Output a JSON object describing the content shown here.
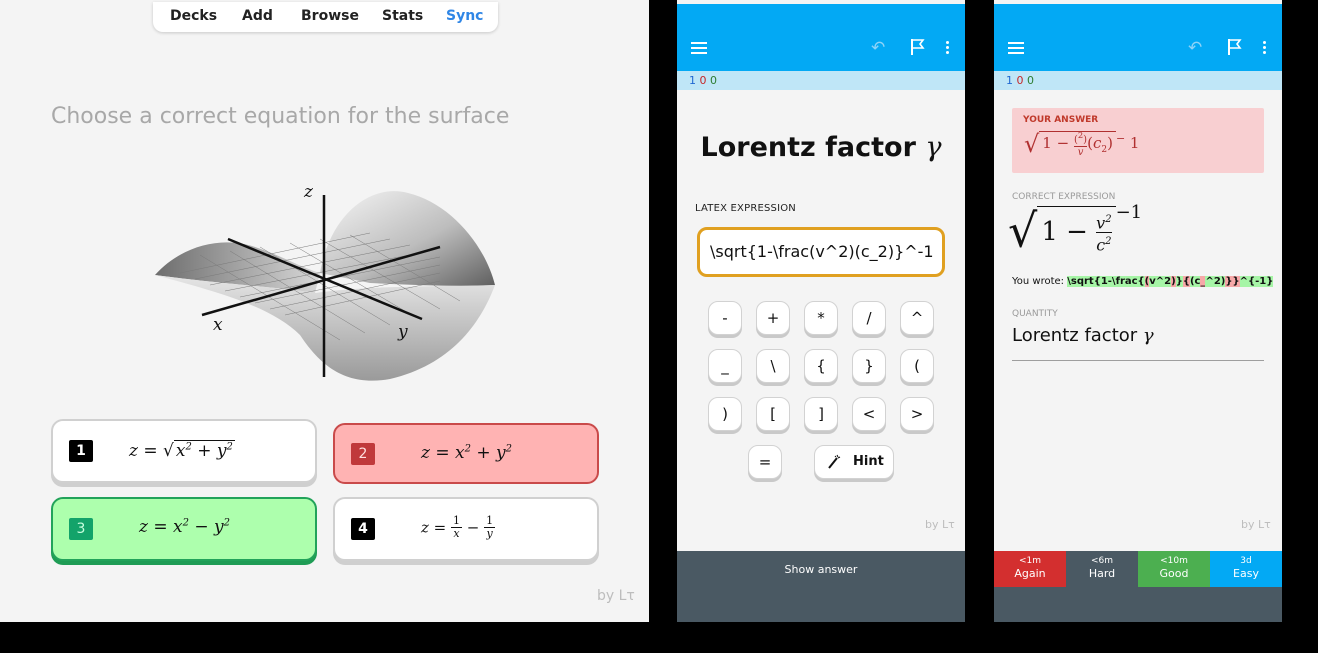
{
  "left": {
    "tabs": [
      "Decks",
      "Add",
      "Browse",
      "Stats",
      "Sync"
    ],
    "question": "Choose a correct equation for the surface",
    "axes": {
      "z": "z",
      "x": "x",
      "y": "y"
    },
    "options": [
      {
        "num": "1",
        "formula": "z = √(x² + y²)",
        "state": "normal"
      },
      {
        "num": "2",
        "formula": "z = x² + y²",
        "state": "wrong"
      },
      {
        "num": "3",
        "formula": "z = x² − y²",
        "state": "correct"
      },
      {
        "num": "4",
        "formula": "z = 1/x − 1/y",
        "state": "normal"
      }
    ],
    "footer": "by Lτ"
  },
  "phone2": {
    "counts": [
      "1",
      "0",
      "0"
    ],
    "title": "Lorentz factor",
    "title_symbol": "γ",
    "input_label": "LATEX EXPRESSION",
    "input_value": "\\sqrt{1-\\frac(v^2)(c_2)}^-1",
    "keys": [
      "-",
      "+",
      "*",
      "/",
      "^",
      "_",
      "\\",
      "{",
      "}",
      "(",
      ")",
      "[",
      "]",
      "<",
      ">",
      "="
    ],
    "hint_label": "Hint",
    "footer": "by Lτ",
    "show_answer": "Show answer"
  },
  "phone3": {
    "counts": [
      "1",
      "0",
      "0"
    ],
    "your_answer_label": "YOUR ANSWER",
    "correct_label": "CORRECT EXPRESSION",
    "you_wrote_label": "You wrote:",
    "wrote_parts": [
      "\\sqrt{1-\\frac{",
      "(",
      "v^2",
      ")",
      "}",
      "{",
      "(c",
      "_",
      "^2)",
      "}}",
      "^{-1}"
    ],
    "quantity_label": "QUANTITY",
    "quantity_value": "Lorentz factor",
    "quantity_symbol": "γ",
    "footer": "by Lτ",
    "ease": [
      {
        "time": "<1m",
        "label": "Again",
        "color": "#d32f2f"
      },
      {
        "time": "<6m",
        "label": "Hard",
        "color": "#4a5963"
      },
      {
        "time": "<10m",
        "label": "Good",
        "color": "#4caf50"
      },
      {
        "time": "3d",
        "label": "Easy",
        "color": "#03a9f4"
      }
    ]
  }
}
